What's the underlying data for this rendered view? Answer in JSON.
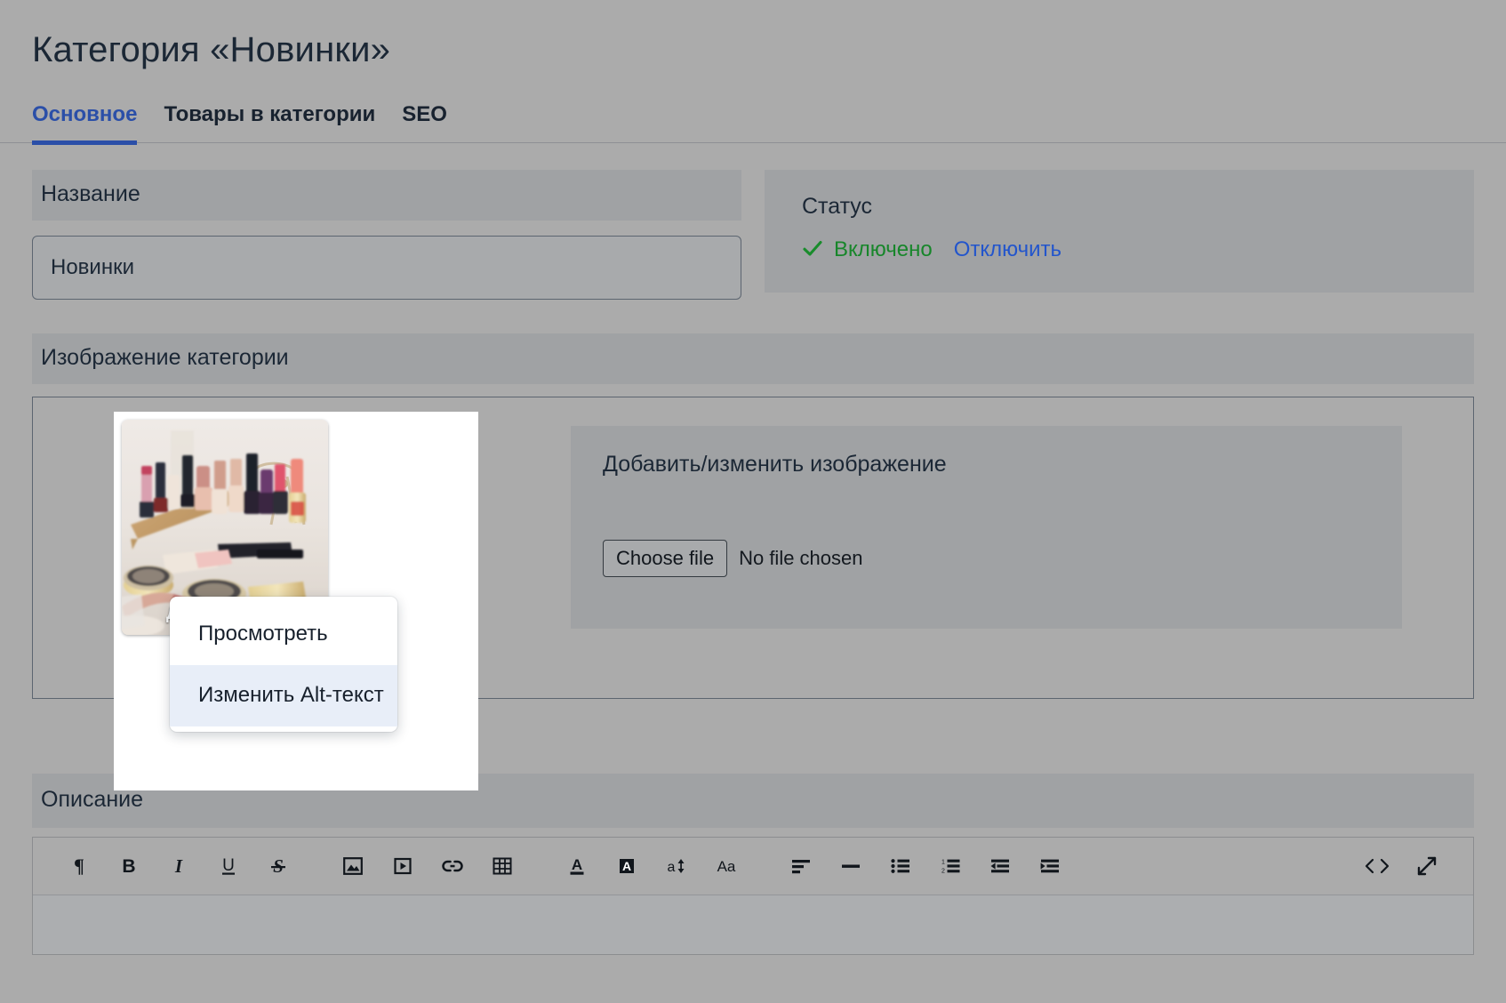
{
  "page": {
    "title": "Категория «Новинки»"
  },
  "tabs": [
    {
      "label": "Основное",
      "active": true
    },
    {
      "label": "Товары в категории",
      "active": false
    },
    {
      "label": "SEO",
      "active": false
    }
  ],
  "name_field": {
    "label": "Название",
    "value": "Новинки",
    "placeholder": ""
  },
  "status": {
    "title": "Статус",
    "check_icon": "check-icon",
    "enabled_label": "Включено",
    "disable_link": "Отключить",
    "enabled_color": "#17862a",
    "link_color": "#2255cc"
  },
  "image_section": {
    "label": "Изображение категории",
    "thumbnail_alt": "Косметика на столе",
    "actions_label": "Действия",
    "chevron_icon": "chevron-down-icon",
    "menu": [
      {
        "label": "Просмотреть",
        "highlighted": false
      },
      {
        "label": "Изменить Alt-текст",
        "highlighted": true
      }
    ],
    "upload": {
      "label": "Добавить/изменить изображение",
      "choose_file_label": "Choose file",
      "no_file_label": "No file chosen"
    }
  },
  "description": {
    "label": "Описание",
    "content": "",
    "toolbar": [
      {
        "name": "paragraph-icon",
        "glyph": "¶",
        "title": "Абзац"
      },
      {
        "name": "bold-icon",
        "glyph": "B",
        "title": "Полужирный"
      },
      {
        "name": "italic-icon",
        "glyph": "I",
        "title": "Курсив"
      },
      {
        "name": "underline-icon",
        "glyph": "U",
        "title": "Подчёркнутый"
      },
      {
        "name": "strikethrough-icon",
        "glyph": "S",
        "title": "Зачёркнутый"
      },
      {
        "name": "image-icon",
        "glyph": "",
        "title": "Изображение"
      },
      {
        "name": "video-icon",
        "glyph": "",
        "title": "Видео"
      },
      {
        "name": "link-icon",
        "glyph": "",
        "title": "Ссылка"
      },
      {
        "name": "table-icon",
        "glyph": "",
        "title": "Таблица"
      },
      {
        "name": "text-color-icon",
        "glyph": "A",
        "title": "Цвет текста"
      },
      {
        "name": "highlight-color-icon",
        "glyph": "A",
        "title": "Цвет фона"
      },
      {
        "name": "font-size-icon",
        "glyph": "a",
        "title": "Размер шрифта"
      },
      {
        "name": "font-family-icon",
        "glyph": "Aa",
        "title": "Шрифт"
      },
      {
        "name": "align-icon",
        "glyph": "",
        "title": "Выравнивание"
      },
      {
        "name": "horizontal-rule-icon",
        "glyph": "",
        "title": "Линия"
      },
      {
        "name": "bullet-list-icon",
        "glyph": "",
        "title": "Маркированный список"
      },
      {
        "name": "numbered-list-icon",
        "glyph": "",
        "title": "Нумерованный список"
      },
      {
        "name": "outdent-icon",
        "glyph": "",
        "title": "Уменьшить отступ"
      },
      {
        "name": "indent-icon",
        "glyph": "",
        "title": "Увеличить отступ"
      },
      {
        "name": "source-code-icon",
        "glyph": "<>",
        "title": "Исходный код"
      },
      {
        "name": "fullscreen-icon",
        "glyph": "",
        "title": "Полный экран"
      }
    ]
  },
  "theme": {
    "background": "#ababab",
    "label_strip": "#a0a2a4",
    "accent_blue": "#2b4fa8",
    "menu_hover": "#e8eef8"
  }
}
